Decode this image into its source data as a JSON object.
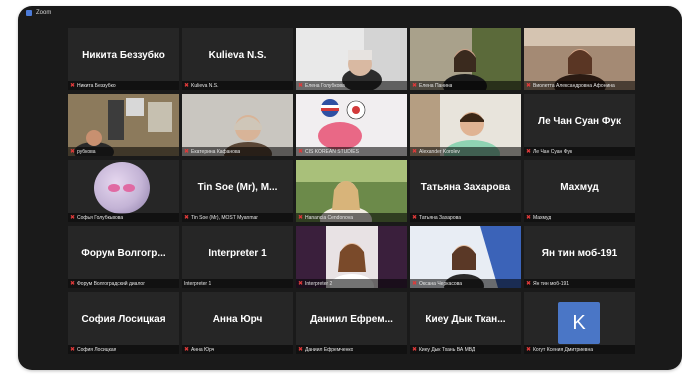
{
  "window": {
    "title": "Zoom"
  },
  "tiles": [
    {
      "big": "Никита Беззубко",
      "small": "Никита Беззубко"
    },
    {
      "big": "Kulieva N.S.",
      "small": "Kulieva N.S."
    },
    {
      "big": "",
      "small": "Елена Голубкова"
    },
    {
      "big": "",
      "small": "Елена Панина"
    },
    {
      "big": "",
      "small": "Виолетта Александровна Афонина"
    },
    {
      "big": "",
      "small": "рубкова"
    },
    {
      "big": "",
      "small": "Екатерина Кафанова"
    },
    {
      "big": "",
      "small": "CIS KOREAN STUDIES"
    },
    {
      "big": "",
      "small": "Alexander Korolev"
    },
    {
      "big": "Ле Чан Суан Фук",
      "small": "Ле Чан Суан Фук"
    },
    {
      "big": "",
      "small": "Софья Голубкьвова"
    },
    {
      "big": "Tin Soe (Mr), M...",
      "small": "Tin Soe (Mr), MOST Myanmar"
    },
    {
      "big": "",
      "small": "Hanancia Cendonova"
    },
    {
      "big": "Татьяна Захарова",
      "small": "Татьяна Захарова"
    },
    {
      "big": "Махмуд",
      "small": "Махмуд"
    },
    {
      "big": "Форум Волгогр...",
      "small": "Форум Волгоградский диалог"
    },
    {
      "big": "Interpreter 1",
      "small": "Interpreter 1"
    },
    {
      "big": "",
      "small": "Interpreter 2"
    },
    {
      "big": "",
      "small": "Оксана Черкасова"
    },
    {
      "big": "Ян тин моб-191",
      "small": "Ян тин моб-191"
    },
    {
      "big": "София Лосицкая",
      "small": "София Лосицкая"
    },
    {
      "big": "Анна Юрч",
      "small": "Анна Юрч"
    },
    {
      "big": "Даниил Ефрем...",
      "small": "Даниил Ефремченко"
    },
    {
      "big": "Киеу Дык Ткан...",
      "small": "Киеу Дык Тхань ВА МВД"
    },
    {
      "big": "",
      "small": "Когут Ксения Дмитриевна",
      "avatar_letter": "K"
    }
  ],
  "colors": {
    "tile_bg": "#262626",
    "active_speaker_border": "#c6e02a",
    "muted_icon": "#e03a3a",
    "avatar_k_bg": "#4a76c6"
  }
}
